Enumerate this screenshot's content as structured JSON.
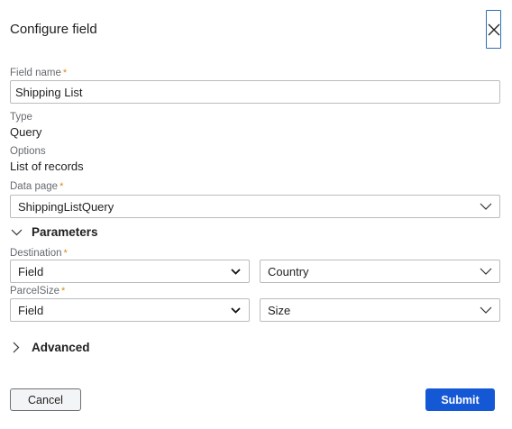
{
  "dialog": {
    "title": "Configure field"
  },
  "field_name": {
    "label": "Field name",
    "value": "Shipping List"
  },
  "type": {
    "label": "Type",
    "value": "Query"
  },
  "options": {
    "label": "Options",
    "value": "List of records"
  },
  "data_page": {
    "label": "Data page",
    "value": "ShippingListQuery"
  },
  "parameters": {
    "title": "Parameters",
    "expanded": true,
    "items": [
      {
        "label": "Destination",
        "source": "Field",
        "value": "Country"
      },
      {
        "label": "ParcelSize",
        "source": "Field",
        "value": "Size"
      }
    ]
  },
  "advanced": {
    "title": "Advanced",
    "expanded": false
  },
  "buttons": {
    "cancel": "Cancel",
    "submit": "Submit"
  },
  "required_mark": "*",
  "colors": {
    "accent": "#1558d6",
    "required": "#d88a1f",
    "focus_border": "#2d6fb8"
  },
  "icons": {
    "close": "close-icon",
    "chevron_down": "chevron-down-icon",
    "chevron_right": "chevron-right-icon"
  }
}
